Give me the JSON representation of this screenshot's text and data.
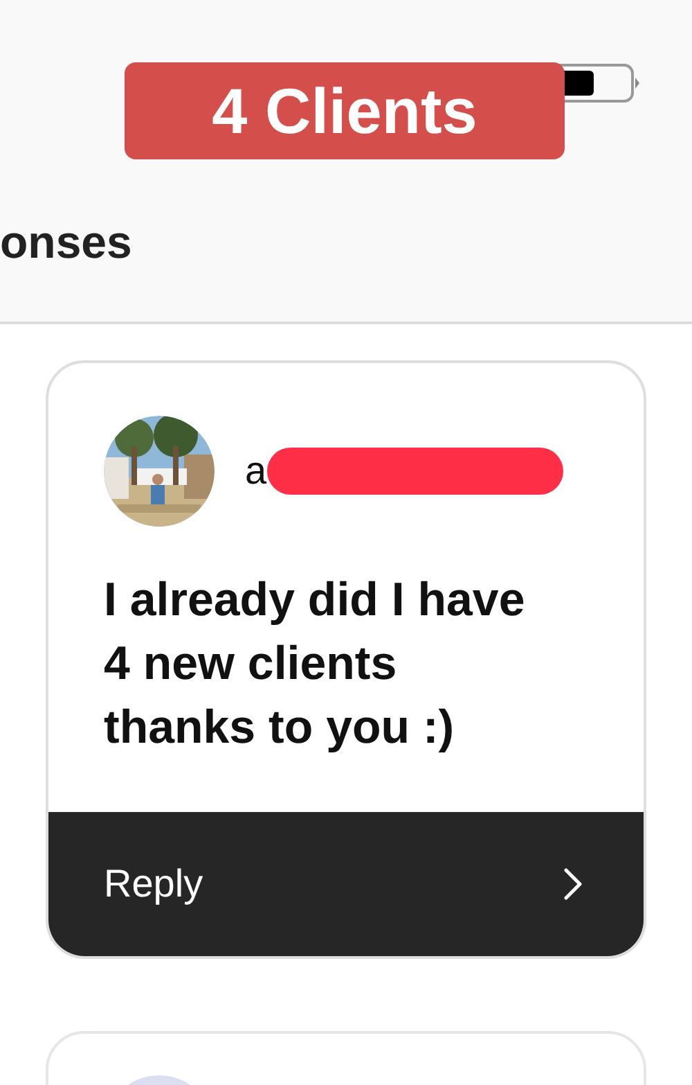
{
  "overlay_label": "4 Clients",
  "header": {
    "title": "onses"
  },
  "responses": [
    {
      "kind": "full",
      "name": "a",
      "redacted": true,
      "message_lines": [
        "I already did I have",
        "4 new clients",
        "thanks to you :)"
      ],
      "reply_label": "Reply"
    },
    {
      "kind": "partial"
    }
  ]
}
